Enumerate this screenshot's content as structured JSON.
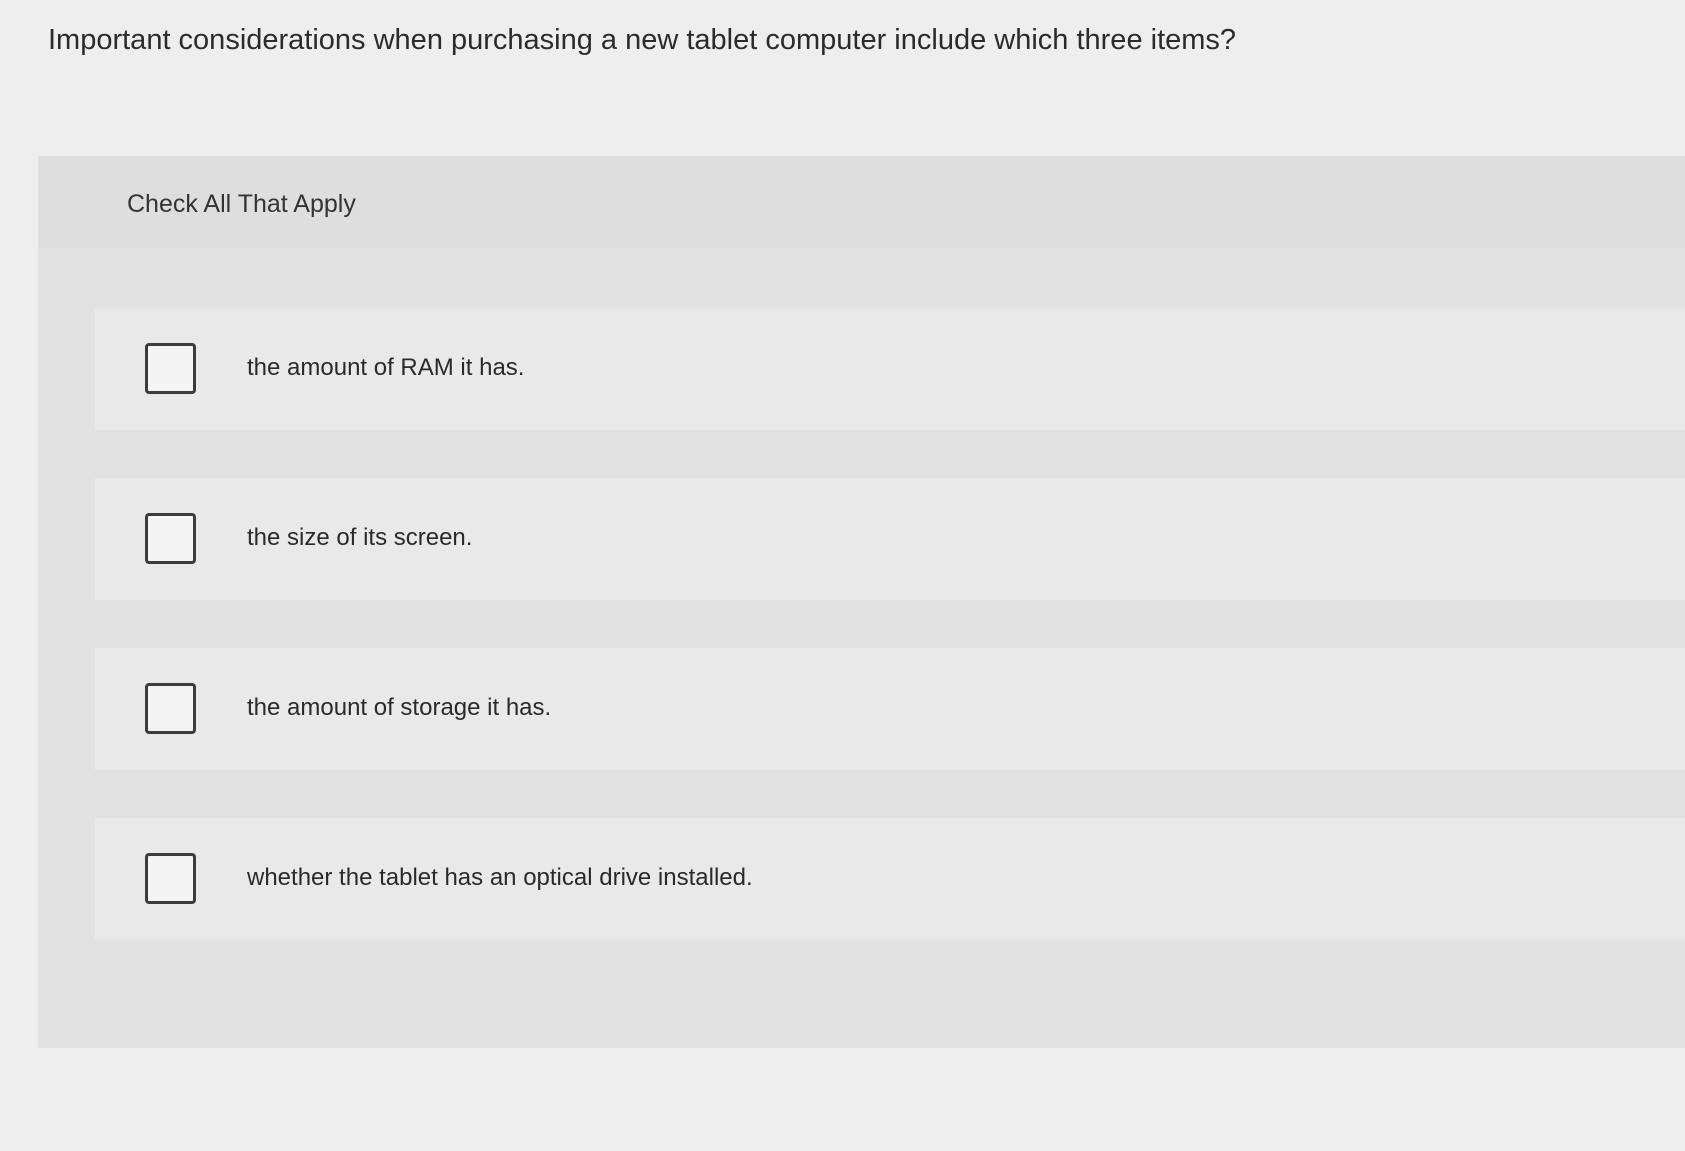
{
  "question": {
    "text": "Important considerations when purchasing a new tablet computer include which three items?"
  },
  "panel": {
    "instruction": "Check All That Apply",
    "options": [
      {
        "label": "the amount of RAM it has.",
        "checked": false
      },
      {
        "label": "the size of its screen.",
        "checked": false
      },
      {
        "label": "the amount of storage it has.",
        "checked": false
      },
      {
        "label": "whether the tablet has an optical drive installed.",
        "checked": false
      }
    ]
  }
}
